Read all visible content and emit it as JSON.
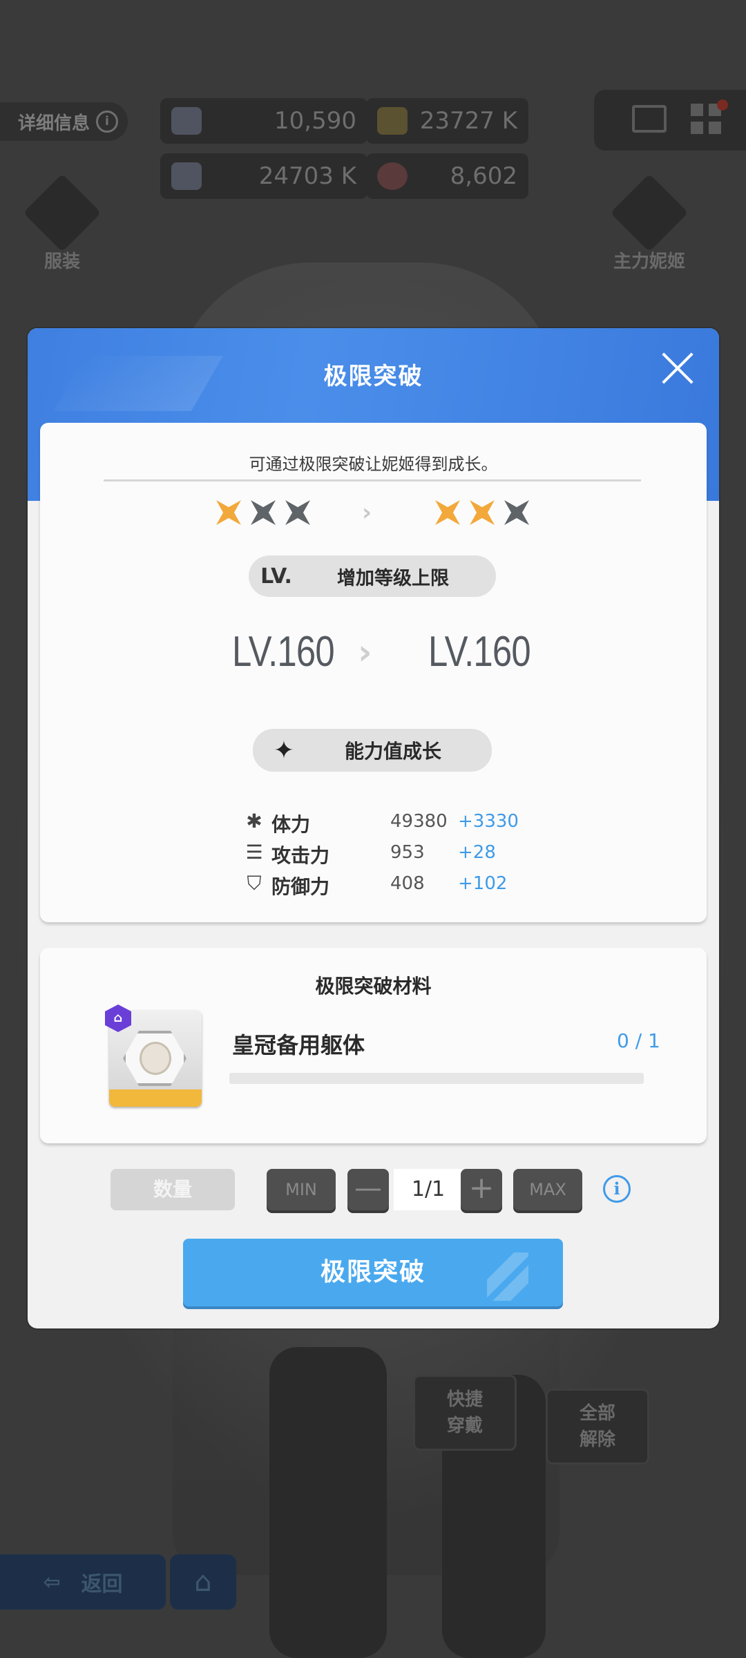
{
  "background": {
    "detail_label": "详细信息",
    "resources": [
      {
        "icon": "crystal-icon",
        "value": "10,590"
      },
      {
        "icon": "credit-card-icon",
        "value": "23727 K"
      },
      {
        "icon": "battle-data-icon",
        "value": "24703 K"
      },
      {
        "icon": "core-dust-icon",
        "value": "8,602"
      }
    ],
    "costume_label": "服装",
    "main_nikke_label": "主力妮姬",
    "quick_equip_label": "快捷\n穿戴",
    "remove_all_label": "全部\n解除",
    "back_label": "返回"
  },
  "modal": {
    "title": "极限突破",
    "description": "可通过极限突破让妮姬得到成长。",
    "stars_before": [
      "gold",
      "gray",
      "gray"
    ],
    "stars_after": [
      "gold",
      "gold",
      "gray"
    ],
    "lv_tag": "LV.",
    "level_cap_label": "增加等级上限",
    "level_before": "LV.160",
    "level_after": "LV.160",
    "growth_label": "能力值成长",
    "stats": [
      {
        "icon": "hp-icon",
        "name": "体力",
        "value": "49380",
        "add": "+3330"
      },
      {
        "icon": "attack-icon",
        "name": "攻击力",
        "value": "953",
        "add": "+28"
      },
      {
        "icon": "defense-icon",
        "name": "防御力",
        "value": "408",
        "add": "+102"
      }
    ],
    "materials_title": "极限突破材料",
    "material": {
      "name": "皇冠备用躯体",
      "count": "0 / 1",
      "progress": 0
    },
    "quantity_label": "数量",
    "min_label": "MIN",
    "max_label": "MAX",
    "quantity_value": "1/1",
    "confirm_label": "极限突破"
  },
  "colors": {
    "header_blue": "#3f7fe0",
    "accent_blue": "#3f9be8",
    "star_gold": "#f2a83a",
    "button_blue": "#4aa9ee"
  }
}
